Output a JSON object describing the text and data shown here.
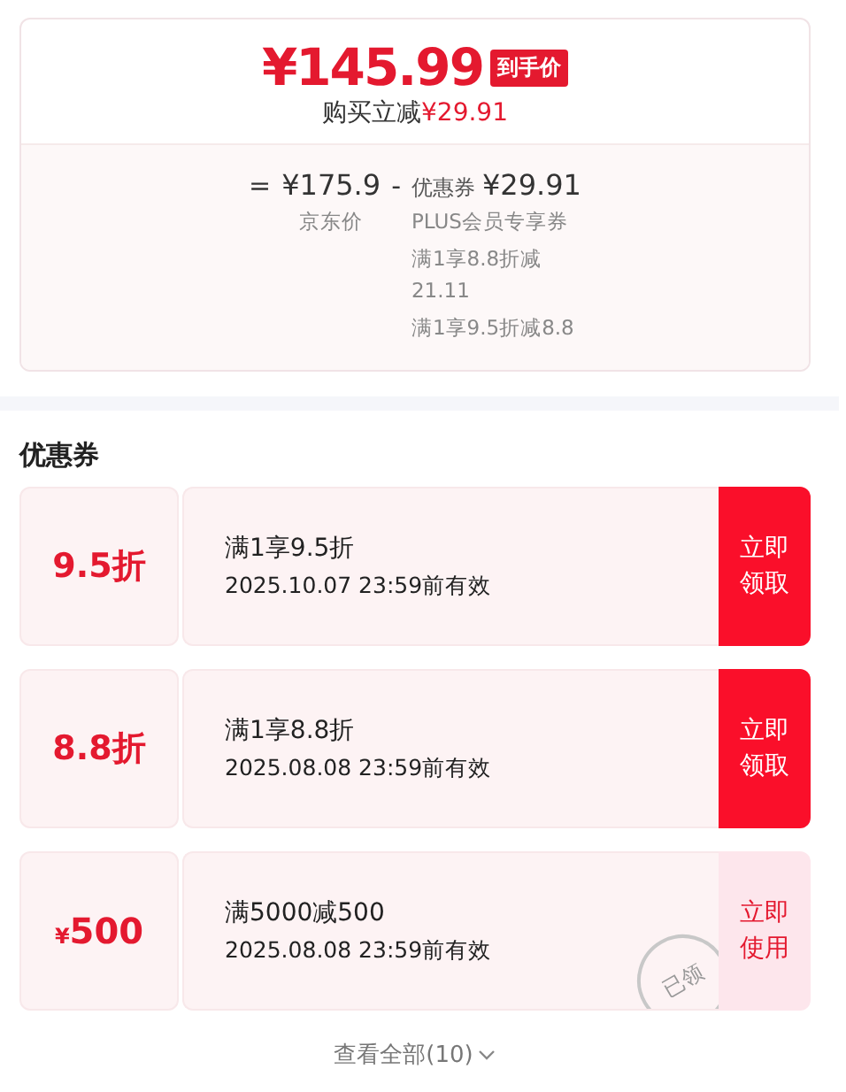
{
  "price": {
    "final": "¥145.99",
    "badge": "到手价",
    "saving_label": "购买立减",
    "saving_amount": "¥29.91"
  },
  "breakdown": {
    "equals": "=",
    "base_price": "¥175.9",
    "base_label": "京东价",
    "minus": "-",
    "coupon_label": "优惠券",
    "coupon_amount": "¥29.91",
    "details": [
      "PLUS会员专享券",
      "满1享8.8折减21.11",
      "满1享9.5折减8.8"
    ]
  },
  "coupons_title": "优惠券",
  "coupons": [
    {
      "kind": "discount",
      "value": "9.5折",
      "condition": "满1享9.5折",
      "validity": "2025.10.07 23:59前有效",
      "action": "立即领取",
      "claimed": false
    },
    {
      "kind": "discount",
      "value": "8.8折",
      "condition": "满1享8.8折",
      "validity": "2025.08.08 23:59前有效",
      "action": "立即领取",
      "claimed": false
    },
    {
      "kind": "cash",
      "currency": "¥",
      "value": "500",
      "condition": "满5000减500",
      "validity": "2025.08.08 23:59前有效",
      "action": "立即使用",
      "claimed": true,
      "stamp": "已领"
    }
  ],
  "view_all": "查看全部(10)"
}
